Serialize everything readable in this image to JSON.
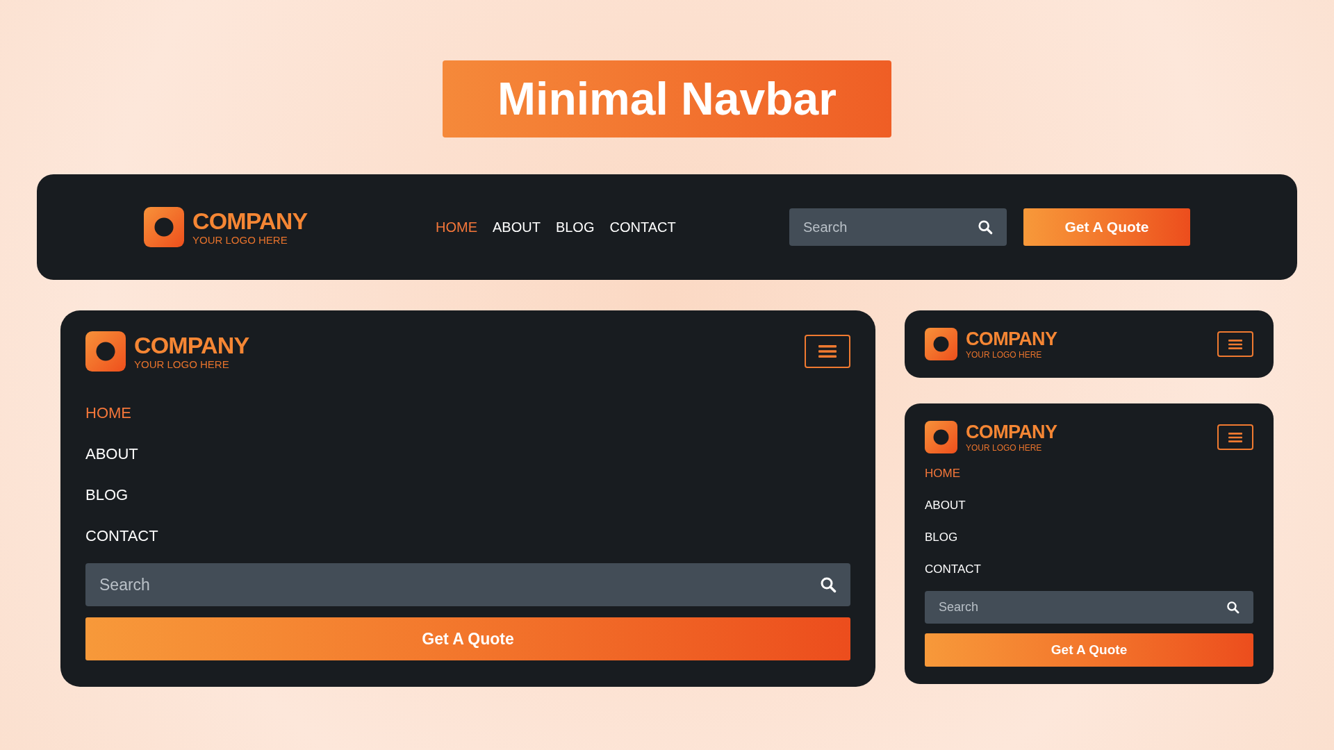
{
  "title": "Minimal Navbar",
  "navbars": [
    {
      "kind": "desktop",
      "logo": {
        "name": "COMPANY",
        "tagline": "YOUR LOGO HERE"
      },
      "links": [
        {
          "label": "HOME",
          "selected": true
        },
        {
          "label": "ABOUT",
          "selected": false
        },
        {
          "label": "BLOG",
          "selected": false
        },
        {
          "label": "CONTACT",
          "selected": false
        }
      ],
      "search": {
        "placeholder": "Search"
      },
      "button": "Get A Quote"
    },
    {
      "kind": "tablet",
      "expanded": true,
      "logo": {
        "name": "COMPANY",
        "tagline": "YOUR LOGO HERE"
      },
      "links": [
        {
          "label": "HOME",
          "selected": true
        },
        {
          "label": "ABOUT",
          "selected": false
        },
        {
          "label": "BLOG",
          "selected": false
        },
        {
          "label": "CONTACT",
          "selected": false
        }
      ],
      "search": {
        "placeholder": "Search"
      },
      "button": "Get A Quote"
    },
    {
      "kind": "mobile",
      "expanded": false,
      "logo": {
        "name": "COMPANY",
        "tagline": "YOUR LOGO HERE"
      }
    },
    {
      "kind": "mobile",
      "expanded": true,
      "logo": {
        "name": "COMPANY",
        "tagline": "YOUR LOGO HERE"
      },
      "links": [
        {
          "label": "HOME",
          "selected": true
        },
        {
          "label": "ABOUT",
          "selected": false
        },
        {
          "label": "BLOG",
          "selected": false
        },
        {
          "label": "CONTACT",
          "selected": false
        }
      ],
      "search": {
        "placeholder": "Search"
      },
      "button": "Get A Quote"
    }
  ]
}
